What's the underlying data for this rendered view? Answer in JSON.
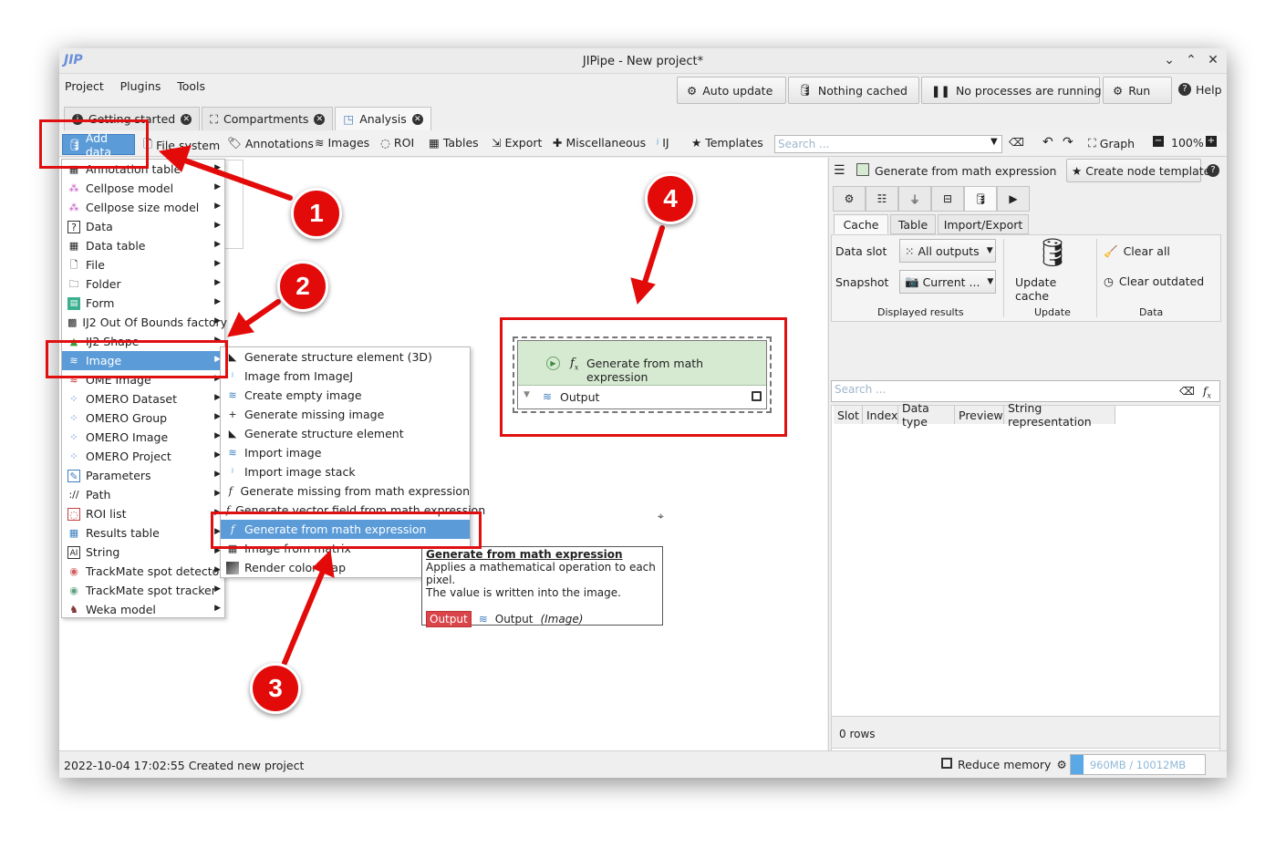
{
  "window": {
    "title": "JIPipe - New project*",
    "logo_text": "JIP"
  },
  "menubar": [
    "Project",
    "Plugins",
    "Tools"
  ],
  "top_buttons": {
    "auto_update": "Auto update",
    "cache": "Nothing cached",
    "processes": "No processes are running",
    "run": "Run",
    "help": "Help"
  },
  "tabs": [
    {
      "label": "Getting started"
    },
    {
      "label": "Compartments"
    },
    {
      "label": "Analysis"
    }
  ],
  "toolbar": {
    "add_data": "Add data",
    "file_system": "File system",
    "annotations": "Annotations",
    "images": "Images",
    "roi": "ROI",
    "tables": "Tables",
    "export": "Export",
    "miscellaneous": "Miscellaneous",
    "ij": "IJ",
    "templates": "Templates",
    "search_placeholder": "Search ...",
    "graph": "Graph",
    "zoom": "100%"
  },
  "add_data_menu": [
    "Annotation table",
    "Cellpose model",
    "Cellpose size model",
    "Data",
    "Data table",
    "File",
    "Folder",
    "Form",
    "IJ2 Out Of Bounds factory",
    "IJ2 Shape",
    "Image",
    "OME Image",
    "OMERO Dataset",
    "OMERO Group",
    "OMERO Image",
    "OMERO Project",
    "Parameters",
    "Path",
    "ROI list",
    "Results table",
    "String",
    "TrackMate spot detector",
    "TrackMate spot tracker",
    "Weka model"
  ],
  "image_submenu": [
    "Generate structure element (3D)",
    "Image from ImageJ",
    "Create empty image",
    "Generate missing image",
    "Generate structure element",
    "Import image",
    "Import image stack",
    "Generate missing from math expression",
    "Generate vector field from math expression",
    "Generate from math expression",
    "Image from matrix",
    "Render color map"
  ],
  "tooltip": {
    "title": "Generate from math expression",
    "line1": "Applies a mathematical operation to each pixel.",
    "line2": "The value is written into the image.",
    "output_badge": "Output",
    "output_label": "Output",
    "output_type": "(Image)"
  },
  "node": {
    "title": "Generate from math expression",
    "output": "Output"
  },
  "right_panel": {
    "node_title": "Generate from math expression",
    "create_template": "Create node template",
    "sub_tabs": [
      "Cache",
      "Table",
      "Import/Export"
    ],
    "data_slot_label": "Data slot",
    "data_slot_value": "All outputs",
    "snapshot_label": "Snapshot",
    "snapshot_value": "Current ...",
    "update_cache": "Update cache",
    "clear_all": "Clear all",
    "clear_outdated": "Clear outdated",
    "group_displayed": "Displayed results",
    "group_update": "Update",
    "group_data": "Data",
    "search_placeholder": "Search ...",
    "columns": [
      "Slot",
      "Index",
      "Data type",
      "Preview",
      "String representation"
    ],
    "rows_count": "0 rows"
  },
  "status": {
    "message": "2022-10-04 17:02:55 Created new project",
    "reduce_memory": "Reduce memory",
    "memory": "960MB / 10012MB",
    "memory_fraction": 0.096
  },
  "callouts": [
    "1",
    "2",
    "3",
    "4"
  ],
  "colors": {
    "selection": "#5a9bd8",
    "annotation_red": "#e01010",
    "node_fill": "#d6ead2"
  }
}
